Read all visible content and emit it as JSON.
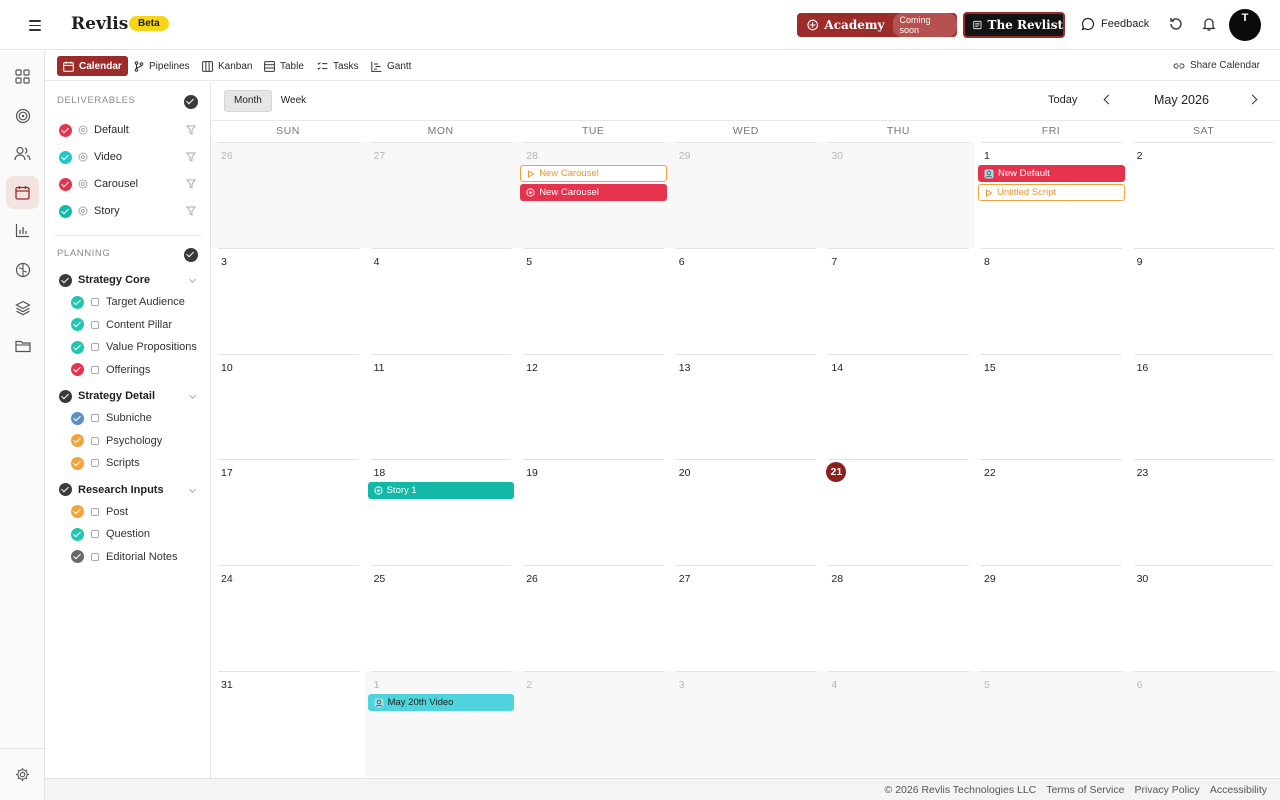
{
  "app": {
    "name": "Revlis",
    "badge": "Beta"
  },
  "header": {
    "academy_label": "Academy",
    "academy_badge": "Coming soon",
    "revlist_label": "The Revlist",
    "feedback_label": "Feedback",
    "avatar_initial": "T",
    "colors": {
      "brand": "#9b2c2a",
      "dark": "#141414",
      "beta": "#f5d516"
    }
  },
  "views": {
    "tabs": [
      {
        "label": "Calendar",
        "icon": "calendar-icon",
        "active": true
      },
      {
        "label": "Pipelines",
        "icon": "branch-icon"
      },
      {
        "label": "Kanban",
        "icon": "columns-icon"
      },
      {
        "label": "Table",
        "icon": "table-icon"
      },
      {
        "label": "Tasks",
        "icon": "checklist-icon"
      },
      {
        "label": "Gantt",
        "icon": "gantt-icon"
      }
    ],
    "share_label": "Share Calendar"
  },
  "sidebar": {
    "deliverables_title": "DELIVERABLES",
    "deliverables": [
      {
        "label": "Default",
        "color": "#e5334e"
      },
      {
        "label": "Video",
        "color": "#22c5d0"
      },
      {
        "label": "Carousel",
        "color": "#e5334e"
      },
      {
        "label": "Story",
        "color": "#14b8a6"
      }
    ],
    "planning_title": "PLANNING",
    "groups": [
      {
        "label": "Strategy Core",
        "items": [
          {
            "label": "Target Audience",
            "color": "#22c5b0"
          },
          {
            "label": "Content Pillar",
            "color": "#22c5b0"
          },
          {
            "label": "Value Propositions",
            "color": "#22c5b0"
          },
          {
            "label": "Offerings",
            "color": "#e5334e"
          }
        ]
      },
      {
        "label": "Strategy Detail",
        "items": [
          {
            "label": "Subniche",
            "color": "#5b8fc9"
          },
          {
            "label": "Psychology",
            "color": "#f2a33a"
          },
          {
            "label": "Scripts",
            "color": "#f2a33a"
          }
        ]
      },
      {
        "label": "Research Inputs",
        "items": [
          {
            "label": "Post",
            "color": "#f2a33a"
          },
          {
            "label": "Question",
            "color": "#22c5b0"
          },
          {
            "label": "Editorial Notes",
            "color": "#6a6a6a"
          }
        ]
      }
    ]
  },
  "calendar": {
    "modes": [
      "Month",
      "Week"
    ],
    "active_mode": "Month",
    "today_label": "Today",
    "month_label": "May 2026",
    "weekdays": [
      "SUN",
      "MON",
      "TUE",
      "WED",
      "THU",
      "FRI",
      "SAT"
    ],
    "today_date": "21",
    "weeks": [
      [
        "26",
        "27",
        "28",
        "29",
        "30",
        "1",
        "2"
      ],
      [
        "3",
        "4",
        "5",
        "6",
        "7",
        "8",
        "9"
      ],
      [
        "10",
        "11",
        "12",
        "13",
        "14",
        "15",
        "16"
      ],
      [
        "17",
        "18",
        "19",
        "20",
        "21",
        "22",
        "23"
      ],
      [
        "24",
        "25",
        "26",
        "27",
        "28",
        "29",
        "30"
      ],
      [
        "31",
        "1",
        "2",
        "3",
        "4",
        "5",
        "6"
      ]
    ],
    "muted_cells": [
      [
        0,
        0
      ],
      [
        0,
        1
      ],
      [
        0,
        2
      ],
      [
        0,
        3
      ],
      [
        0,
        4
      ],
      [
        5,
        1
      ],
      [
        5,
        2
      ],
      [
        5,
        3
      ],
      [
        5,
        4
      ],
      [
        5,
        5
      ],
      [
        5,
        6
      ]
    ],
    "events": [
      {
        "week": 0,
        "day": 2,
        "slot": 0,
        "label": "New Carousel",
        "style": "outline",
        "icon": "play-icon"
      },
      {
        "week": 0,
        "day": 2,
        "slot": 1,
        "label": "New Carousel",
        "style": "red",
        "icon": "carousel-icon"
      },
      {
        "week": 0,
        "day": 5,
        "slot": 0,
        "label": "New Default",
        "style": "red",
        "icon": "avatar-icon"
      },
      {
        "week": 0,
        "day": 5,
        "slot": 1,
        "label": "Untitled Script",
        "style": "outline",
        "icon": "play-icon"
      },
      {
        "week": 3,
        "day": 1,
        "slot": 0,
        "label": "Story 1",
        "style": "teal",
        "icon": "story-icon"
      },
      {
        "week": 5,
        "day": 1,
        "slot": 0,
        "label": "May 20th Video",
        "style": "cyan",
        "icon": "avatar-icon"
      }
    ]
  },
  "footer": {
    "copyright": "© 2026 Revlis Technologies LLC",
    "links": [
      "Terms of Service",
      "Privacy Policy",
      "Accessibility"
    ]
  }
}
